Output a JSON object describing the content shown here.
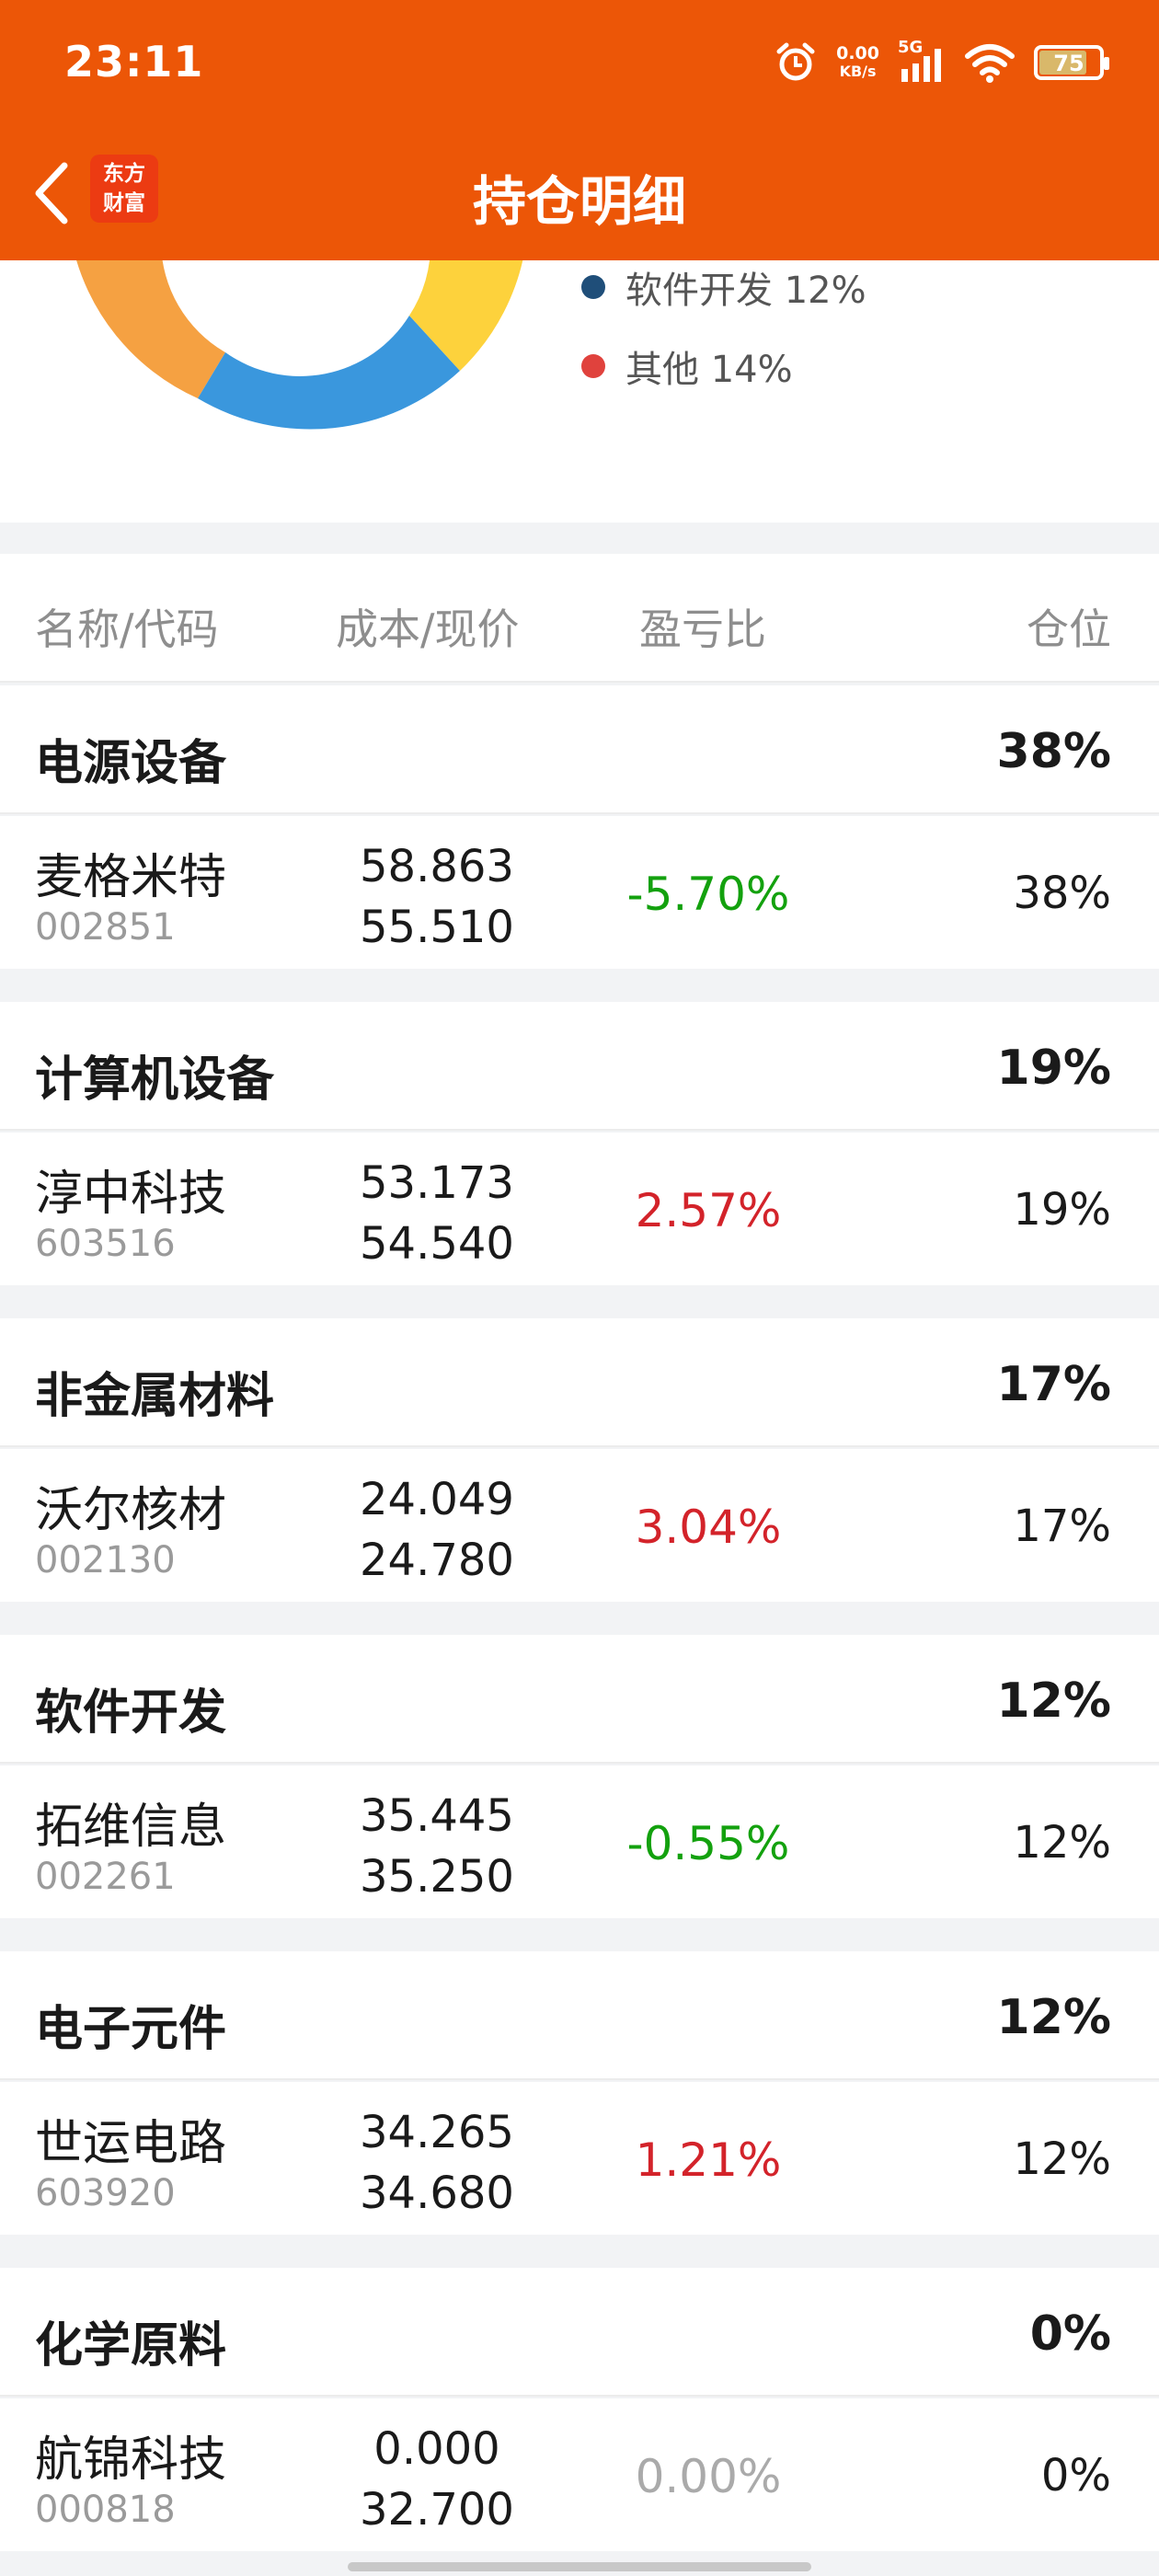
{
  "status_bar": {
    "time": "23:11",
    "net_speed": "0.00",
    "net_unit": "KB/s",
    "network": "5G",
    "battery": "75"
  },
  "nav": {
    "title": "持仓明细",
    "logo_line1": "东方",
    "logo_line2": "财富"
  },
  "legend": [
    {
      "label": "软件开发 12%",
      "color": "#1f4e79"
    },
    {
      "label": "其他 14%",
      "color": "#e0423d"
    }
  ],
  "donut_colors": {
    "orange": "#f5a142",
    "blue": "#3a97dd",
    "yellow": "#fdd23c"
  },
  "table": {
    "headers": {
      "name": "名称/代码",
      "cost": "成本/现价",
      "pnl": "盈亏比",
      "position": "仓位"
    }
  },
  "sectors": [
    {
      "name": "电源设备",
      "pct": "38%",
      "stock": {
        "name": "麦格米特",
        "code": "002851",
        "cost": "58.863",
        "price": "55.510",
        "pnl": "-5.70%",
        "trend": "down",
        "pos": "38%"
      }
    },
    {
      "name": "计算机设备",
      "pct": "19%",
      "stock": {
        "name": "淳中科技",
        "code": "603516",
        "cost": "53.173",
        "price": "54.540",
        "pnl": "2.57%",
        "trend": "up",
        "pos": "19%"
      }
    },
    {
      "name": "非金属材料",
      "pct": "17%",
      "stock": {
        "name": "沃尔核材",
        "code": "002130",
        "cost": "24.049",
        "price": "24.780",
        "pnl": "3.04%",
        "trend": "up",
        "pos": "17%"
      }
    },
    {
      "name": "软件开发",
      "pct": "12%",
      "stock": {
        "name": "拓维信息",
        "code": "002261",
        "cost": "35.445",
        "price": "35.250",
        "pnl": "-0.55%",
        "trend": "down",
        "pos": "12%"
      }
    },
    {
      "name": "电子元件",
      "pct": "12%",
      "stock": {
        "name": "世运电路",
        "code": "603920",
        "cost": "34.265",
        "price": "34.680",
        "pnl": "1.21%",
        "trend": "up",
        "pos": "12%"
      }
    },
    {
      "name": "化学原料",
      "pct": "0%",
      "stock": {
        "name": "航锦科技",
        "code": "000818",
        "cost": "0.000",
        "price": "32.700",
        "pnl": "0.00%",
        "trend": "flat",
        "pos": "0%"
      }
    }
  ]
}
